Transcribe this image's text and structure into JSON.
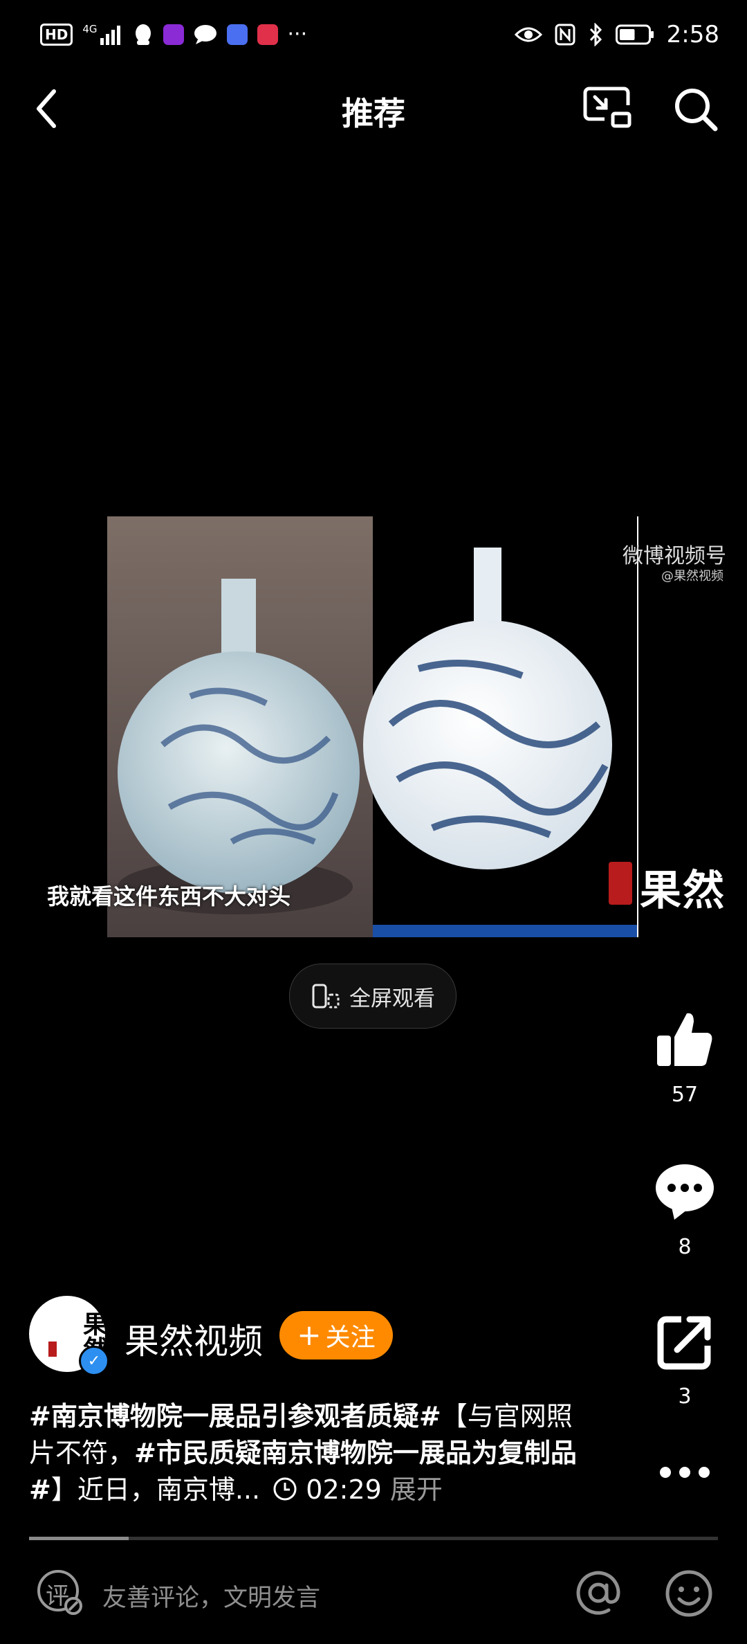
{
  "status_bar": {
    "network_badge": "HD",
    "network_type": "4G",
    "time": "2:58",
    "battery_level": 0.55,
    "notification_icons": [
      "signal-icon",
      "qq-icon",
      "pen-app-icon",
      "chat-icon",
      "music-icon",
      "book-icon",
      "more-dots-icon"
    ],
    "right_icons": [
      "eye-icon",
      "nfc-icon",
      "bluetooth-icon",
      "battery-icon"
    ]
  },
  "header": {
    "title": "推荐",
    "back_icon": "chevron-left-icon",
    "cast_icon": "screen-cast-icon",
    "search_icon": "search-icon"
  },
  "video": {
    "subtitle": "我就看这件东西不大对头",
    "watermark_brand": "微博视频号",
    "watermark_account": "@果然视频",
    "brand_mark": "果然",
    "fullscreen_label": "全屏观看"
  },
  "actions": {
    "likes": "57",
    "comments": "8",
    "shares": "3"
  },
  "author": {
    "name": "果然视频",
    "follow_label": "关注",
    "avatar_text": "果然"
  },
  "description": {
    "tag1": "#南京博物院一展品引参观者质疑#",
    "text1": "【与官网照片不符，",
    "tag2": "#市民质疑南京博物院一展品为复制品#",
    "text2": "】近日，南京博...",
    "duration": "02:29",
    "expand_label": "展开"
  },
  "playback": {
    "progress": 0.145
  },
  "comment_bar": {
    "comment_icon_label": "评",
    "placeholder": "友善评论，文明发言"
  },
  "colors": {
    "accent": "#ff8a00",
    "verified": "#2d8ff0",
    "background": "#000000"
  }
}
